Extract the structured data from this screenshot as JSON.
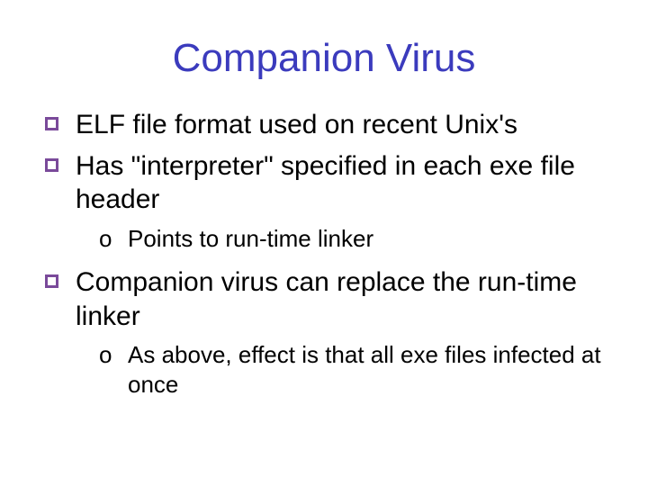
{
  "title": "Companion Virus",
  "bullets": {
    "b1": "ELF file format used on recent Unix's",
    "b2": "Has \"interpreter\" specified in each exe file header",
    "b2_sub1": "Points to run-time linker",
    "b3": "Companion virus can replace the run-time linker",
    "b3_sub1": "As above, effect is that all exe files infected at once"
  }
}
